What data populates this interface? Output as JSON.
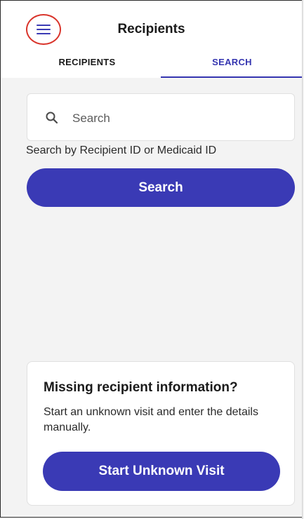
{
  "header": {
    "title": "Recipients",
    "menu_icon": "hamburger-menu-icon",
    "menu_highlight_color": "#d9342b"
  },
  "tabs": [
    {
      "label": "RECIPIENTS",
      "active": false
    },
    {
      "label": "SEARCH",
      "active": true
    }
  ],
  "search": {
    "placeholder": "Search",
    "value": "",
    "icon": "search-icon",
    "hint": "Search by Recipient ID or Medicaid ID",
    "button_label": "Search"
  },
  "unknown_visit": {
    "title": "Missing recipient information?",
    "description": "Start an unknown visit and enter the details manually.",
    "button_label": "Start Unknown Visit"
  },
  "colors": {
    "primary": "#3a3ab5",
    "background": "#f3f3f3",
    "surface": "#ffffff"
  }
}
